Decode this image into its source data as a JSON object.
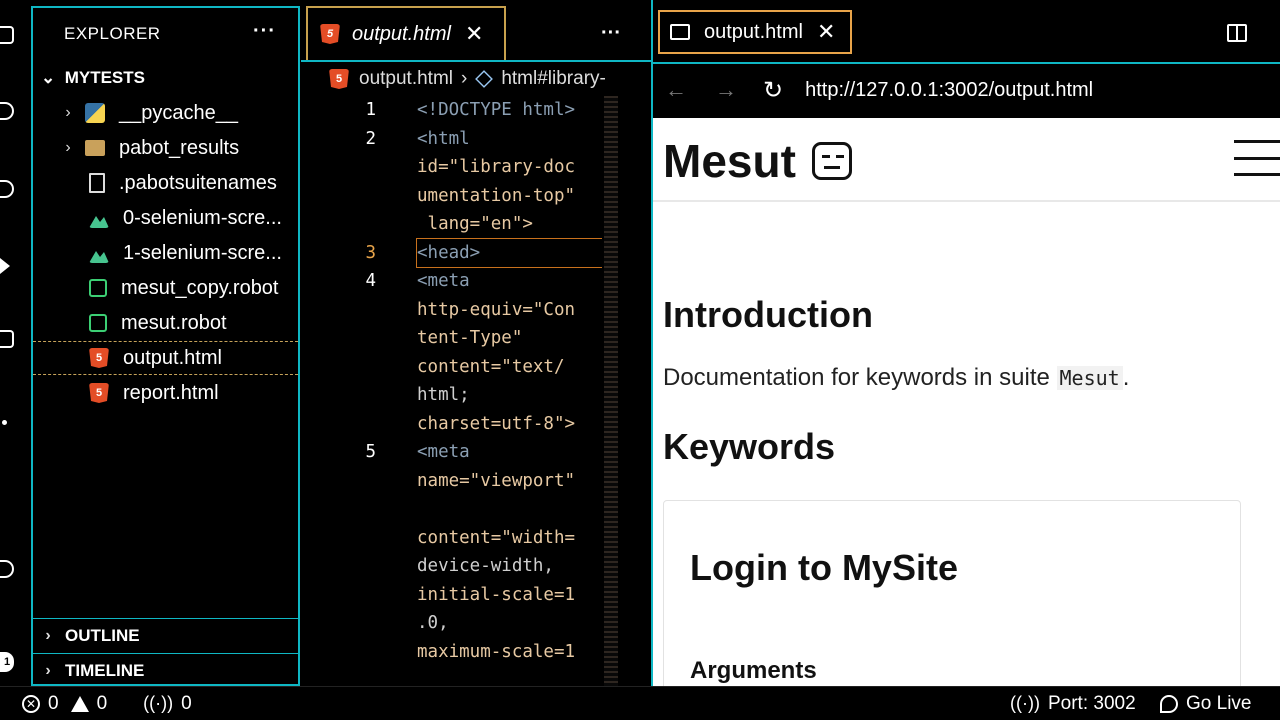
{
  "sidebar": {
    "title": "EXPLORER",
    "more": "···",
    "folder": "MYTESTS",
    "items": [
      {
        "label": "__pycache__",
        "icon": "python-folder-icon",
        "chevron": "›"
      },
      {
        "label": "pabot_results",
        "icon": "folder-icon",
        "chevron": "›"
      },
      {
        "label": ".pabotsuitenames",
        "icon": "file-icon"
      },
      {
        "label": "0-selenium-scre...",
        "icon": "image-icon"
      },
      {
        "label": "1-selenium-scre...",
        "icon": "image-icon"
      },
      {
        "label": "mesut_copy.robot",
        "icon": "robot-file-icon"
      },
      {
        "label": "mesut.robot",
        "icon": "robot-file-icon"
      },
      {
        "label": "output.html",
        "icon": "html5-icon"
      },
      {
        "label": "report.html",
        "icon": "html5-icon"
      }
    ],
    "outline": "OUTLINE",
    "timeline": "TIMELINE"
  },
  "editor": {
    "tab_label": "output.html",
    "close": "✕",
    "more": "···",
    "breadcrumb_file": "output.html",
    "breadcrumb_sep": "›",
    "breadcrumb_symbol": "html#library-",
    "lines": [
      {
        "num": "1",
        "text": "<!DOCTYPE html>"
      },
      {
        "num": "2",
        "text": "<html"
      },
      {
        "num": "",
        "text": "id=\"library-doc"
      },
      {
        "num": "",
        "text": "umentation-top\""
      },
      {
        "num": "",
        "text": " lang=\"en\">"
      },
      {
        "num": "3",
        "text": "<head>"
      },
      {
        "num": "4",
        "text": "<meta"
      },
      {
        "num": "",
        "text": "http-equiv=\"Con"
      },
      {
        "num": "",
        "text": "tent-Type\""
      },
      {
        "num": "",
        "text": "content=\"text/"
      },
      {
        "num": "",
        "text": "html;"
      },
      {
        "num": "",
        "text": "charset=utf-8\">"
      },
      {
        "num": "5",
        "text": "<meta"
      },
      {
        "num": "",
        "text": "name=\"viewport\""
      },
      {
        "num": "",
        "text": ""
      },
      {
        "num": "",
        "text": "content=\"width="
      },
      {
        "num": "",
        "text": "device-width,"
      },
      {
        "num": "",
        "text": "initial-scale=1"
      },
      {
        "num": "",
        "text": ".0,"
      },
      {
        "num": "",
        "text": "maximum-scale=1"
      }
    ]
  },
  "preview": {
    "tab_label": "output.html",
    "close": "✕",
    "back": "←",
    "forward": "→",
    "reload": "↻",
    "url": "http://127.0.0.1:3002/output.html",
    "brand": "Mesut",
    "intro_heading": "Introduction",
    "intro_text": "Documentation for keywords in suite ",
    "intro_code": "Mesut",
    "intro_end": ".",
    "keywords_heading": "Keywords",
    "card_title": "Login to MySite",
    "card_sub": "Arguments"
  },
  "status": {
    "errors": "0",
    "warnings": "0",
    "ports": "0",
    "port_label": "Port: 3002",
    "go_live": "Go Live",
    "badge": "1"
  },
  "colors": {
    "accent_border": "#0fb7c4",
    "active_tab": "#e8a44a",
    "html5": "#e44d26",
    "robot": "#3ccf74"
  }
}
